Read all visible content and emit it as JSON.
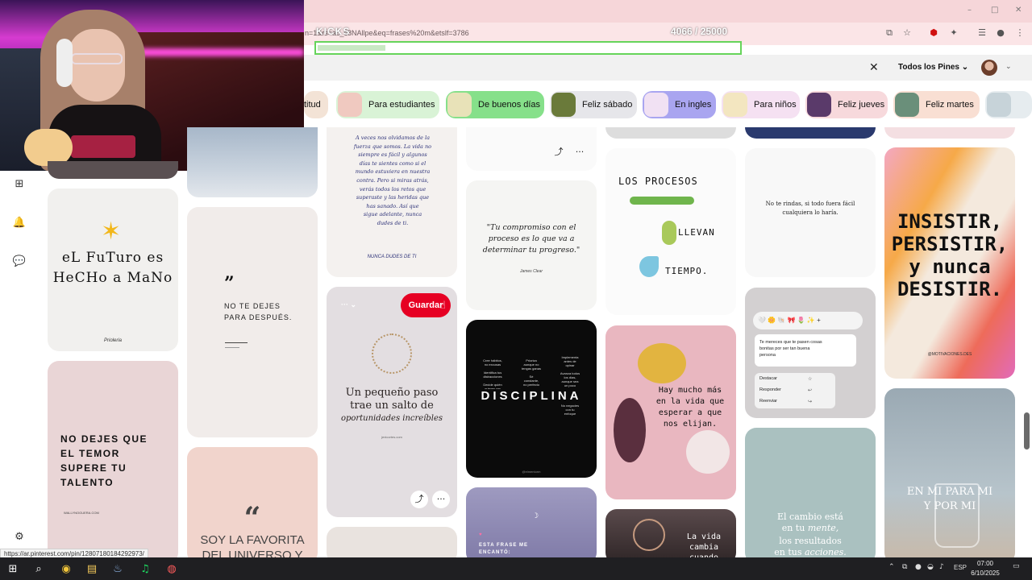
{
  "browser": {
    "url": "n=1&rs=ac_c8NAllpe&eq=frases%20m&etslf=3786",
    "status_url": "https://ar.pinterest.com/pin/12807180184292973/",
    "window_controls": [
      "–",
      "□",
      "✕"
    ]
  },
  "overlay": {
    "title": "KICKS",
    "count": "4066",
    "count_total": "/ 25000",
    "progress_fraction": 0.16
  },
  "header": {
    "close_icon": "✕",
    "filter_label": "Todos los Pines ⌄",
    "avatar_dropdown": "⌄"
  },
  "chips": [
    {
      "label": "titud",
      "bg": "#f3e3d6",
      "thumb": ""
    },
    {
      "label": "Para estudiantes",
      "bg": "#d9f3d6",
      "thumb": "#f0c9c0"
    },
    {
      "label": "De buenos días",
      "bg": "#86e08a",
      "thumb": "#e8e2b8"
    },
    {
      "label": "Feliz sábado",
      "bg": "#e6e6ea",
      "thumb": "#6a7a3a"
    },
    {
      "label": "En ingles",
      "bg": "#a9a5f0",
      "thumb": "#f1e1f3"
    },
    {
      "label": "Para niños",
      "bg": "#f5e1f2",
      "thumb": "#f3e6c0"
    },
    {
      "label": "Feliz jueves",
      "bg": "#f7d9dc",
      "thumb": "#5a3a6a"
    },
    {
      "label": "Feliz martes",
      "bg": "#f9dfd3",
      "thumb": "#6a8f7a"
    },
    {
      "label": "",
      "bg": "#e6ecef",
      "thumb": "#c7d3d9"
    }
  ],
  "pins": {
    "futuro": {
      "text": "eL FuTuro es\nHeCHo a MaNo",
      "credit": "Prioleria"
    },
    "no_dejes": {
      "quote_mark": "”",
      "text": "NO TE DEJES\nPARA DESPUÉS."
    },
    "temor": {
      "text": "NO DEJES QUE\nEL TEMOR\nSUPERE TU\nTALENTO",
      "credit": "WALLYNOGUERA.COM"
    },
    "favorita": {
      "quote_mark": "“",
      "text": "SOY LA FAVORITA\nDEL UNIVERSO Y"
    },
    "handwritten": {
      "text": "A veces nos olvidamos de la\nfuerza que somos. La vida no\nsiempre es fácil y algunos\ndías te sientes como si el\nmundo estuviera en nuestra\ncontra. Pero si miras atrás,\nverás todos los retos que\nsuperaste y las heridas que\nhas sanado. Así que\nsigue adelante, nunca\ndudes de ti.",
      "sign": "NUNCA DUDES DE TI"
    },
    "pequeno": {
      "text": "Un pequeño paso\ntrae un salto de",
      "script": "oportunidades increíbles",
      "credit": "jenicortes.com"
    },
    "compromiso": {
      "text": "\"Tu compromiso con el\nproceso es lo que va a\ndeterminar tu progreso.\"",
      "author": "James Clear"
    },
    "disciplina": {
      "title": "DISCIPLINA",
      "left_items": "Cree hábitos,\nno excusas\n\nIdentifica tus\ndistracciones\n\nDecide quién\nquieres ser",
      "center_items": "Prioriza\naunque no\ntengas ganas\n\nSé\nconstante,\nno perfecto\n\nInvierte\nen lo\nimportante",
      "right_items": "Implementa\nantes de\nopinar\n\nAvanza todos\nlos días,\naunque sea\nun poco\n\nLibérate del\nimpulso fácil\n\nNo negocies\ncon tu\nenfoque",
      "credit": "@elmentorm"
    },
    "frase": {
      "heart": "♥",
      "text": "ESTA FRASE ME\nENCANTÓ:"
    },
    "procesos": {
      "text1": "LOS PROCESOS",
      "text2": "LLEVAN",
      "text3": "TIEMPO."
    },
    "mucho_mas": {
      "text": "Hay mucho más\nen la vida que\nesperar a que\nnos elijan."
    },
    "la_vida": {
      "text": "La vida\ncambia cuando"
    },
    "no_rindas": {
      "text": "No te rindas, si todo fuera fácil\ncualquiera lo haría."
    },
    "chat": {
      "emojis": "🤍 🌼 🐚 🎀 🌷 ✨ +",
      "message": "Te mereces que te pasen cosas\nbonitas por ser tan buena\npersona",
      "menu": [
        "Destacar",
        "Responder",
        "Reenviar"
      ],
      "menu_icons": [
        "☆",
        "↩",
        "↪"
      ]
    },
    "cambio": {
      "text1": "El cambio está\nen tu ",
      "em1": "mente,",
      "text2": "los resultados\nen tus ",
      "em2": "acciones."
    },
    "insistir": {
      "text": "INSISTIR,\nPERSISTIR,\ny nunca\nDESISTIR.",
      "credit": "@MOTIVACIONES.DES"
    },
    "para_mi": {
      "text": "EN MI PARA MI\nY POR MI"
    }
  },
  "hover": {
    "save_label": "Guardar",
    "dots_label": "··· ⌄",
    "share_icon": "⤴",
    "more_icon": "···"
  },
  "sidebar_icons": [
    "⊞",
    "🔔",
    "💬",
    "⚙"
  ],
  "taskbar": {
    "apps": [
      "⊞",
      "⌕",
      "◉",
      "▤",
      "♨",
      "♫",
      "◍"
    ],
    "lang": "ESP",
    "time": "07:00",
    "date": "6/10/2025"
  }
}
